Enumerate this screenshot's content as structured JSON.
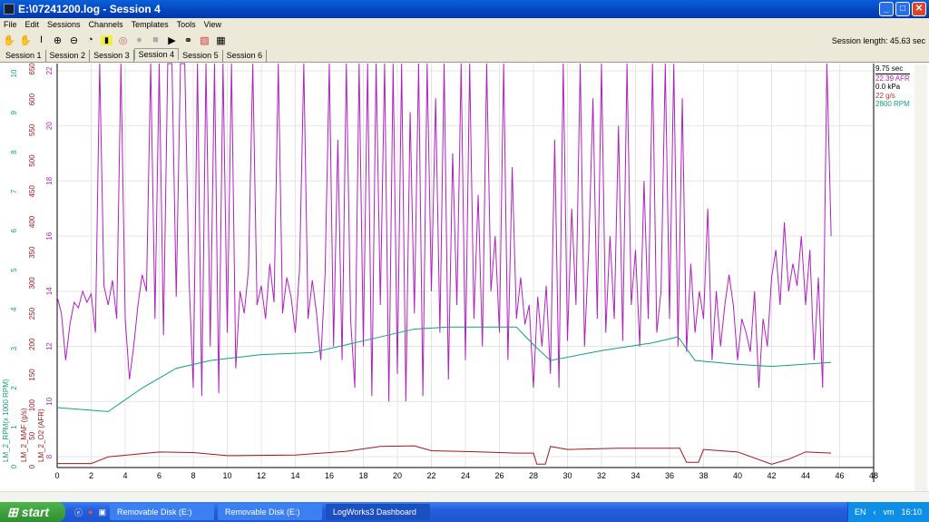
{
  "window": {
    "title": "E:\\07241200.log - Session 4"
  },
  "menu": [
    "File",
    "Edit",
    "Sessions",
    "Channels",
    "Templates",
    "Tools",
    "View"
  ],
  "toolbar": {
    "icons": [
      "hand-icon",
      "hand-disabled-icon",
      "cursor-i-icon",
      "zoom-in-icon",
      "zoom-out-icon",
      "zoom-fit-icon",
      "note-icon",
      "eye-icon",
      "record-icon",
      "stop-icon",
      "play-icon",
      "binoculars-icon",
      "chart-icon",
      "table-icon"
    ],
    "session_length_label": "Session length:",
    "session_length_value": "45.63 sec"
  },
  "tabs": [
    {
      "label": "Session 1"
    },
    {
      "label": "Session 2"
    },
    {
      "label": "Session 3"
    },
    {
      "label": "Session 4",
      "active": true
    },
    {
      "label": "Session 5"
    },
    {
      "label": "Session 6"
    }
  ],
  "legend": {
    "time": "9.75 sec",
    "afr": "22.39 AFR",
    "kpa": "0.0 kPa",
    "maf": "22 g/s",
    "rpm": "2800 RPM"
  },
  "colors": {
    "afr": "#b020c0",
    "maf": "#a01818",
    "rpm": "#10a080"
  },
  "chart_data": {
    "type": "line",
    "xlim": [
      0,
      48
    ],
    "x_ticks": [
      "0",
      "2",
      "4",
      "6",
      "8",
      "10",
      "12",
      "14",
      "16",
      "18",
      "20",
      "22",
      "24",
      "26",
      "28",
      "30",
      "32",
      "34",
      "36",
      "38",
      "40",
      "42",
      "44",
      "46",
      "48"
    ],
    "axes": [
      {
        "label": "LM_2_RPM(x 1000 RPM)",
        "range": [
          0,
          10
        ],
        "ticks": [
          "0",
          "1",
          "2",
          "3",
          "4",
          "5",
          "6",
          "7",
          "8",
          "9",
          "10"
        ]
      },
      {
        "label": "LM_2_MAF (g/s)",
        "range": [
          0,
          650
        ],
        "ticks": [
          "0",
          "50",
          "100",
          "150",
          "200",
          "250",
          "300",
          "350",
          "400",
          "450",
          "500",
          "550",
          "600",
          "650"
        ]
      },
      {
        "label": "LM_2_O2 (AFR)",
        "range": [
          8,
          22
        ],
        "ticks": [
          "8",
          "10",
          "12",
          "14",
          "16",
          "18",
          "20",
          "22"
        ]
      }
    ],
    "grid": true,
    "series": [
      {
        "name": "LM_2_O2 (AFR)",
        "dt": 0.25,
        "values": [
          13.8,
          13.2,
          11.5,
          12.8,
          13.6,
          13.4,
          14.0,
          13.6,
          13.9,
          12.5,
          22.3,
          14.2,
          13.5,
          14.4,
          13.0,
          22.3,
          13.0,
          10.8,
          12.0,
          13.5,
          14.6,
          14.0,
          22.3,
          13.0,
          22.3,
          12.4,
          22.3,
          22.3,
          13.8,
          22.3,
          22.3,
          14.5,
          10.5,
          22.3,
          10.2,
          22.3,
          12.0,
          22.3,
          10.3,
          22.3,
          12.5,
          22.3,
          11.2,
          14.0,
          13.2,
          14.8,
          22.3,
          13.5,
          14.2,
          13.0,
          15.0,
          13.6,
          22.3,
          13.2,
          14.5,
          13.8,
          12.5,
          14.8,
          22.3,
          13.0,
          14.4,
          13.2,
          11.5,
          14.6,
          22.3,
          12.0,
          19.5,
          11.5,
          22.3,
          13.0,
          10.5,
          22.3,
          12.0,
          22.3,
          10.2,
          22.3,
          13.5,
          22.3,
          10.0,
          22.3,
          11.0,
          22.3,
          10.0,
          20.5,
          13.2,
          22.3,
          10.2,
          22.3,
          14.0,
          21.0,
          12.5,
          22.3,
          10.8,
          19.0,
          13.5,
          22.3,
          11.5,
          22.3,
          13.0,
          17.5,
          12.0,
          22.3,
          14.0,
          16.0,
          12.5,
          22.3,
          11.5,
          18.5,
          13.0,
          14.5,
          12.8,
          13.5,
          10.5,
          13.8,
          12.0,
          14.2,
          11.0,
          19.5,
          10.5,
          22.3,
          12.2,
          17.0,
          13.5,
          22.3,
          12.0,
          15.5,
          21.0,
          13.0,
          22.3,
          12.5,
          16.0,
          13.0,
          20.0,
          12.2,
          22.3,
          13.5,
          15.5,
          12.0,
          18.0,
          13.0,
          22.3,
          12.5,
          14.0,
          22.3,
          13.0,
          22.3,
          12.0,
          21.0,
          11.8,
          15.0,
          12.5,
          14.0,
          13.0,
          17.0,
          11.5,
          14.0,
          12.0,
          13.5,
          14.6,
          13.5,
          11.5,
          13.0,
          12.5,
          11.8,
          14.0,
          10.5,
          13.0,
          12.0,
          14.5,
          15.5,
          13.5,
          16.5,
          14.0,
          15.0,
          14.2,
          16.0,
          13.5,
          15.5,
          11.5,
          14.5,
          10.5,
          22.3,
          16.0
        ]
      },
      {
        "name": "LM_2_MAF (g/s)",
        "points": [
          [
            0,
            5
          ],
          [
            2,
            5
          ],
          [
            3,
            16
          ],
          [
            6,
            24
          ],
          [
            8,
            23
          ],
          [
            10,
            18
          ],
          [
            14,
            19
          ],
          [
            17,
            25
          ],
          [
            19,
            33
          ],
          [
            21,
            34
          ],
          [
            22,
            26
          ],
          [
            25,
            24
          ],
          [
            27,
            22
          ],
          [
            28,
            22
          ],
          [
            28.2,
            4
          ],
          [
            28.7,
            4
          ],
          [
            29,
            33
          ],
          [
            30,
            28
          ],
          [
            33,
            30
          ],
          [
            36.6,
            30
          ],
          [
            37,
            7
          ],
          [
            37.7,
            7
          ],
          [
            38,
            28
          ],
          [
            40,
            24
          ],
          [
            42,
            4
          ],
          [
            43,
            12
          ],
          [
            44,
            24
          ],
          [
            45.5,
            22
          ]
        ]
      },
      {
        "name": "LM_2_RPM(x 1000 RPM)",
        "points": [
          [
            0,
            1.5
          ],
          [
            3,
            1.4
          ],
          [
            5,
            2.0
          ],
          [
            7,
            2.5
          ],
          [
            9,
            2.7
          ],
          [
            12,
            2.85
          ],
          [
            15,
            2.9
          ],
          [
            18,
            3.2
          ],
          [
            21,
            3.5
          ],
          [
            23,
            3.55
          ],
          [
            27,
            3.55
          ],
          [
            28,
            3.1
          ],
          [
            29,
            2.7
          ],
          [
            32,
            2.95
          ],
          [
            35,
            3.15
          ],
          [
            36.5,
            3.3
          ],
          [
            37.5,
            2.7
          ],
          [
            40,
            2.6
          ],
          [
            42,
            2.55
          ],
          [
            45.5,
            2.65
          ]
        ]
      }
    ]
  },
  "taskbar": {
    "start": "start",
    "items": [
      "Removable Disk (E:)",
      "Removable Disk (E:)",
      "LogWorks3 Dashboard"
    ],
    "lang": "EN",
    "clock": "16:10"
  }
}
